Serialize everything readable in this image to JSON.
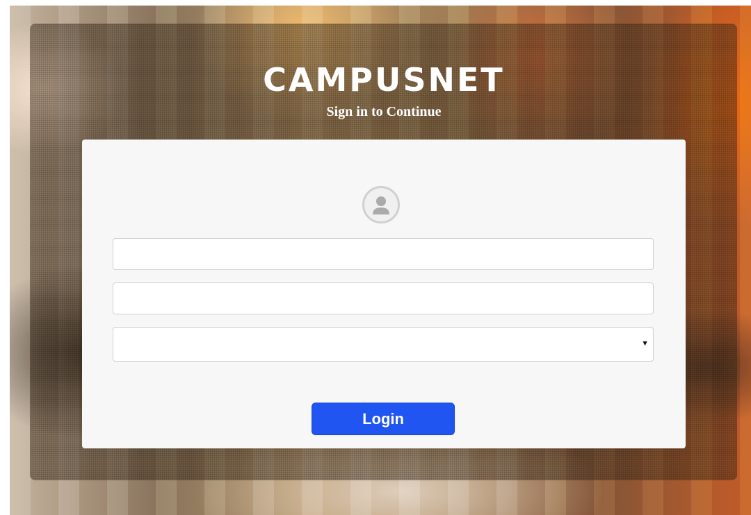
{
  "header": {
    "brand": "CAMPUSNET",
    "subtitle": "Sign in to Continue"
  },
  "login_form": {
    "avatar_icon": "user-avatar-icon",
    "username": {
      "value": "",
      "placeholder": ""
    },
    "password": {
      "value": "",
      "placeholder": ""
    },
    "role_select": {
      "selected": "",
      "icon": "dropdown-arrow-icon"
    },
    "login_label": "Login"
  },
  "colors": {
    "button": "#2155f2",
    "card": "#f7f7f7",
    "text_on_dark": "#ffffff"
  }
}
